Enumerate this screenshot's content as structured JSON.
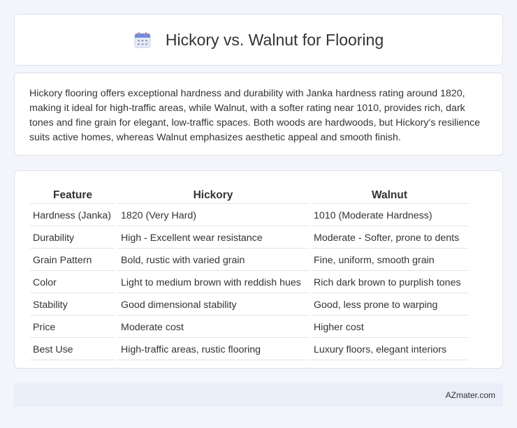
{
  "header": {
    "title": "Hickory vs. Walnut for Flooring",
    "icon": "calendar-icon"
  },
  "intro": {
    "text": "Hickory flooring offers exceptional hardness and durability with Janka hardness rating around 1820, making it ideal for high-traffic areas, while Walnut, with a softer rating near 1010, provides rich, dark tones and fine grain for elegant, low-traffic spaces. Both woods are hardwoods, but Hickory's resilience suits active homes, whereas Walnut emphasizes aesthetic appeal and smooth finish."
  },
  "table": {
    "headers": [
      "Feature",
      "Hickory",
      "Walnut"
    ],
    "rows": [
      [
        "Hardness (Janka)",
        "1820 (Very Hard)",
        "1010 (Moderate Hardness)"
      ],
      [
        "Durability",
        "High - Excellent wear resistance",
        "Moderate - Softer, prone to dents"
      ],
      [
        "Grain Pattern",
        "Bold, rustic with varied grain",
        "Fine, uniform, smooth grain"
      ],
      [
        "Color",
        "Light to medium brown with reddish hues",
        "Rich dark brown to purplish tones"
      ],
      [
        "Stability",
        "Good dimensional stability",
        "Good, less prone to warping"
      ],
      [
        "Price",
        "Moderate cost",
        "Higher cost"
      ],
      [
        "Best Use",
        "High-traffic areas, rustic flooring",
        "Luxury floors, elegant interiors"
      ]
    ]
  },
  "footer": {
    "brand": "AZmater.com"
  }
}
